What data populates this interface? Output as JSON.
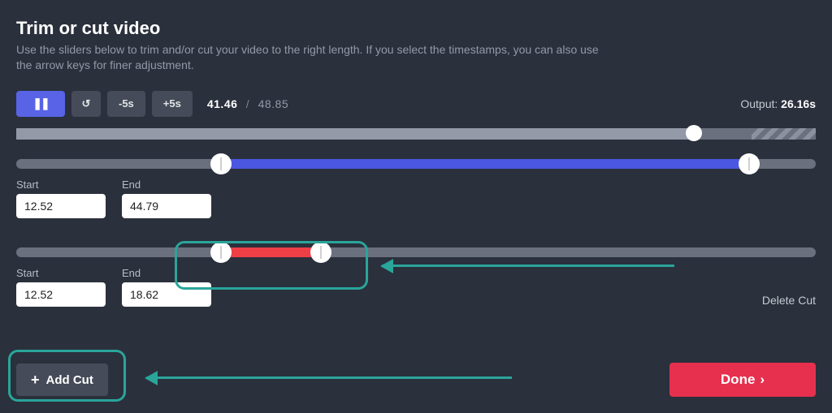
{
  "title": "Trim or cut video",
  "description": "Use the sliders below to trim and/or cut your video to the right length. If you select the timestamps, you can also use the arrow keys for finer adjustment.",
  "controls": {
    "pause": "⏸",
    "restart": "↺",
    "minus5": "-5s",
    "plus5": "+5s"
  },
  "playback": {
    "current": "41.46",
    "separator": "/",
    "duration": "48.85"
  },
  "output": {
    "label": "Output:",
    "value": "26.16s"
  },
  "progress": {
    "playhead_pct": 84.8,
    "stripe_right_pct": 8
  },
  "trim": {
    "range_start_pct": 25.6,
    "range_end_pct": 91.7,
    "start": {
      "label": "Start",
      "value": "12.52"
    },
    "end": {
      "label": "End",
      "value": "44.79"
    }
  },
  "cut": {
    "range_start_pct": 25.6,
    "range_end_pct": 38.1,
    "start": {
      "label": "Start",
      "value": "12.52"
    },
    "end": {
      "label": "End",
      "value": "18.62"
    },
    "delete_label": "Delete Cut"
  },
  "buttons": {
    "add_cut": "Add Cut",
    "done": "Done"
  }
}
